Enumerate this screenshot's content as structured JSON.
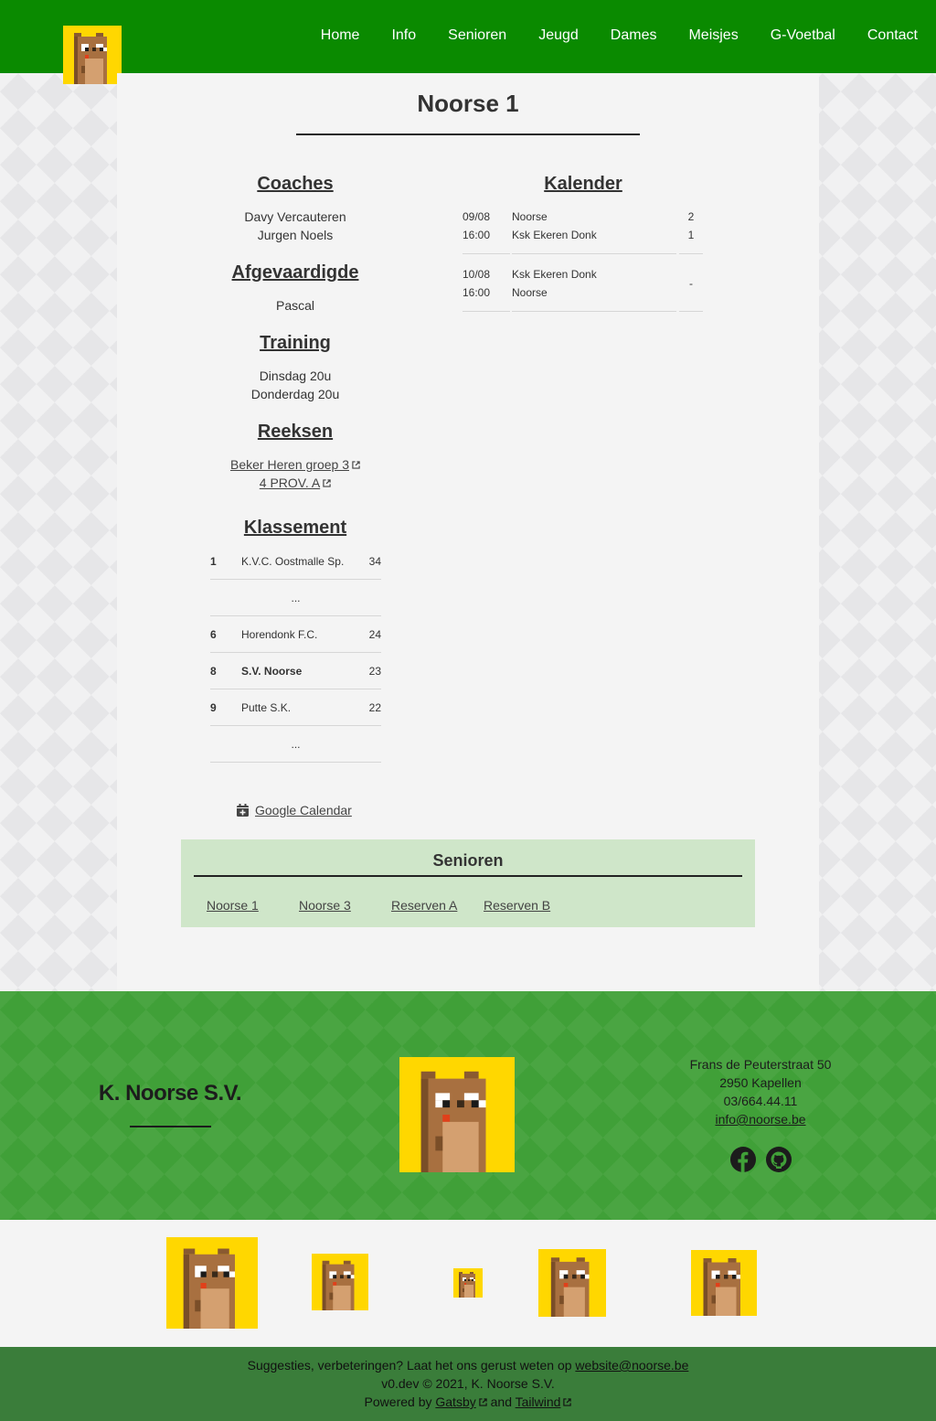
{
  "nav": {
    "items": [
      "Home",
      "Info",
      "Senioren",
      "Jeugd",
      "Dames",
      "Meisjes",
      "G-Voetbal",
      "Contact"
    ]
  },
  "page": {
    "title": "Noorse 1"
  },
  "coaches": {
    "heading": "Coaches",
    "names": [
      "Davy Vercauteren",
      "Jurgen Noels"
    ]
  },
  "delegate": {
    "heading": "Afgevaardigde",
    "name": "Pascal"
  },
  "training": {
    "heading": "Training",
    "times": [
      "Dinsdag 20u",
      "Donderdag 20u"
    ]
  },
  "series": {
    "heading": "Reeksen",
    "links": [
      "Beker Heren groep 3",
      "4 PROV. A"
    ]
  },
  "standings": {
    "heading": "Klassement",
    "rows": [
      {
        "rank": "1",
        "team": "K.V.C. Oostmalle Sp.",
        "points": "34"
      },
      {
        "rank": "",
        "team": "...",
        "points": ""
      },
      {
        "rank": "6",
        "team": "Horendonk F.C.",
        "points": "24"
      },
      {
        "rank": "8",
        "team": "S.V. Noorse",
        "points": "23"
      },
      {
        "rank": "9",
        "team": "Putte S.K.",
        "points": "22"
      },
      {
        "rank": "",
        "team": "...",
        "points": ""
      }
    ]
  },
  "calendar": {
    "heading": "Kalender",
    "matches": [
      {
        "date": "09/08",
        "time": "16:00",
        "home": "Noorse",
        "away": "Ksk Ekeren Donk",
        "score_home": "2",
        "score_away": "1"
      },
      {
        "date": "10/08",
        "time": "16:00",
        "home": "Ksk Ekeren Donk",
        "away": "Noorse",
        "score": "-"
      }
    ],
    "google_label": "Google Calendar"
  },
  "group": {
    "title": "Senioren",
    "links": [
      "Noorse 1",
      "Noorse 3",
      "Reserven A",
      "Reserven B"
    ]
  },
  "footer": {
    "club_name": "K. Noorse S.V.",
    "address_lines": [
      "Frans de Peuterstraat 50",
      "2950 Kapellen",
      "03/664.44.11"
    ],
    "email": "info@noorse.be",
    "social_icons": [
      "facebook-icon",
      "github-icon"
    ]
  },
  "bottom": {
    "suggest_text": "Suggesties, verbeteringen? Laat het ons gerust weten op",
    "suggest_email": "website@noorse.be",
    "version": "v0.dev © 2021, K. Noorse S.V.",
    "powered_prefix": "Powered by",
    "gatsby": "Gatsby",
    "and": "and",
    "tailwind": "Tailwind"
  },
  "colors": {
    "header_green": "#0a8a00",
    "footer_green": "#40a038",
    "bottom_green": "#3a7d3a",
    "group_box": "#cfe6c9",
    "logo_yellow": "#ffd700"
  }
}
